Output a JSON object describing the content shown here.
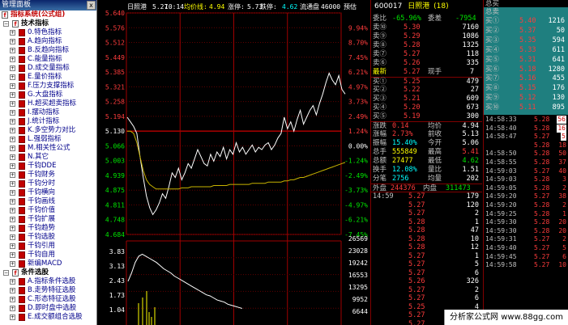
{
  "panel": {
    "title": "管理面板",
    "close": "x",
    "tree": [
      {
        "type": "root",
        "label": "指标系统(公式组)"
      },
      {
        "type": "sec",
        "label": "技术指标"
      },
      {
        "type": "item",
        "label": "0.特色指标"
      },
      {
        "type": "item",
        "label": "A.趋向指标"
      },
      {
        "type": "item",
        "label": "B.反趋向指标"
      },
      {
        "type": "item",
        "label": "C.能量指标"
      },
      {
        "type": "item",
        "label": "D.成交量指标"
      },
      {
        "type": "item",
        "label": "E.量价指标"
      },
      {
        "type": "item",
        "label": "F.压力支撑指标"
      },
      {
        "type": "item",
        "label": "G.大盘指标"
      },
      {
        "type": "item",
        "label": "H.超买超卖指标"
      },
      {
        "type": "item",
        "label": "I.摆动指标"
      },
      {
        "type": "item",
        "label": "J.统计指标"
      },
      {
        "type": "item",
        "label": "K.多空势力对比"
      },
      {
        "type": "item",
        "label": "L.强弱指标"
      },
      {
        "type": "item",
        "label": "M.相关性公式"
      },
      {
        "type": "item",
        "label": "N.其它"
      },
      {
        "type": "item",
        "label": "千钧DDE"
      },
      {
        "type": "item",
        "label": "千钧财务"
      },
      {
        "type": "item",
        "label": "千钧分时"
      },
      {
        "type": "item",
        "label": "千钧横向"
      },
      {
        "type": "item",
        "label": "千钧画线"
      },
      {
        "type": "item",
        "label": "千钧价值"
      },
      {
        "type": "item",
        "label": "千钧扩展"
      },
      {
        "type": "item",
        "label": "千钧趋势"
      },
      {
        "type": "item",
        "label": "千钧选股"
      },
      {
        "type": "item",
        "label": "千钧引用"
      },
      {
        "type": "item",
        "label": "千钧自用"
      },
      {
        "type": "item",
        "label": "新编MACD"
      },
      {
        "type": "sec",
        "label": "条件选股"
      },
      {
        "type": "item",
        "label": "A.指标条件选股"
      },
      {
        "type": "item",
        "label": "B.走势特征选股"
      },
      {
        "type": "item",
        "label": "C.形态特征选股"
      },
      {
        "type": "item",
        "label": "D.即时盘中选股"
      },
      {
        "type": "item",
        "label": "E.成交额组合选股"
      }
    ]
  },
  "chart": {
    "info_name": "日照港",
    "info_time": "5.27",
    "info_clock": "10:14",
    "info_avg_label": "均价线:",
    "info_avg": "4.94",
    "info_chg_label": "涨停:",
    "info_chg": "5.73",
    "info_limit_label": "跌停:",
    "info_limit": "4.62",
    "info_float_label": "流通盘",
    "info_float": "46000",
    "info_warn": "预估",
    "price_labels": [
      "5.640",
      "5.576",
      "5.512",
      "5.449",
      "5.385",
      "5.321",
      "5.258",
      "5.194",
      "5.130",
      "5.066",
      "5.003",
      "4.939",
      "4.875",
      "4.811",
      "4.748",
      "4.684"
    ],
    "pct_labels": [
      "9.94%",
      "8.70%",
      "7.45%",
      "6.21%",
      "4.97%",
      "3.73%",
      "2.49%",
      "1.24%",
      "0.00%",
      "-1.24%",
      "-2.49%",
      "-3.73%",
      "-4.97%",
      "-6.21%",
      "-7.45%"
    ],
    "vol_left_labels": [
      "3.83",
      "3.13",
      "2.43",
      "1.73",
      "1.04"
    ],
    "vol_right_labels": [
      "26569",
      "23028",
      "19242",
      "16553",
      "13295",
      "9952",
      "6644"
    ]
  },
  "chart_data": {
    "type": "line",
    "title": "",
    "xlabel": "",
    "ylabel": "",
    "prev_close": 5.13,
    "ylim": [
      4.684,
      5.64
    ],
    "series": [
      {
        "name": "",
        "values": [
          5.19,
          5.17,
          5.15,
          5.12,
          5.02,
          4.93,
          4.85,
          4.8,
          4.77,
          4.79,
          4.82,
          4.86,
          4.84,
          4.89,
          4.95,
          4.93,
          4.97,
          4.92,
          4.95,
          4.99,
          4.97,
          5.01,
          5.05,
          5.02,
          4.99,
          4.98,
          5.03,
          5.0,
          5.04,
          5.02,
          5.06,
          5.01,
          5.05,
          5.03,
          5.08,
          5.04,
          5.06,
          5.03,
          5.05,
          5.07,
          5.04,
          5.06,
          5.05,
          5.07,
          5.08,
          5.05,
          5.07,
          5.1,
          5.12,
          5.19,
          5.14,
          5.17,
          5.13,
          5.18,
          5.22,
          5.16,
          5.19,
          5.22,
          5.24,
          5.2,
          5.25,
          5.29,
          5.34,
          5.38,
          5.35,
          5.33,
          5.37,
          5.31,
          5.29
        ]
      },
      {
        "name": "",
        "values": [
          5.13,
          5.13,
          5.12,
          5.08,
          5.02,
          4.96,
          4.92,
          4.9,
          4.89,
          4.88,
          4.88,
          4.88,
          4.88,
          4.88,
          4.88,
          4.88,
          4.88,
          4.885,
          4.885,
          4.885,
          4.89,
          4.89,
          4.89,
          4.89,
          4.89,
          4.89,
          4.89,
          4.895,
          4.895,
          4.895,
          4.895,
          4.895,
          4.9,
          4.9,
          4.9,
          4.9,
          4.9,
          4.9,
          4.9,
          4.905,
          4.905,
          4.905,
          4.905,
          4.905,
          4.91,
          4.91,
          4.91,
          4.91,
          4.91,
          4.915,
          4.915,
          4.92,
          4.92,
          4.925,
          4.93,
          4.93,
          4.935,
          4.94,
          4.945,
          4.95,
          4.955,
          4.96,
          4.965,
          4.97,
          4.975,
          4.98,
          4.985,
          4.99,
          4.995
        ]
      }
    ],
    "volume_line": [
      2.4,
      2.8,
      3.3,
      3.6,
      3.7,
      3.6,
      3.5,
      3.4,
      3.3,
      3.15,
      3.0,
      2.9,
      2.8,
      2.65,
      2.55,
      2.45,
      2.35,
      2.25,
      2.15,
      2.05,
      1.95,
      1.85,
      1.75,
      1.7,
      1.6,
      1.5,
      1.45,
      1.4,
      1.3,
      1.25,
      1.2,
      1.15,
      1.1
    ]
  },
  "quote": {
    "code": "600017",
    "name": "日照港",
    "count": "(18)",
    "weibi_label": "委比",
    "weibi": "-65.96%",
    "weicha_label": "委差",
    "weicha": "-7954",
    "sells": [
      {
        "label": "卖⑩",
        "price": "5.30",
        "vol": "7160"
      },
      {
        "label": "卖⑨",
        "price": "5.29",
        "vol": "1086"
      },
      {
        "label": "卖⑧",
        "price": "5.28",
        "vol": "1325"
      },
      {
        "label": "卖⑦",
        "price": "5.27",
        "vol": "118"
      },
      {
        "label": "卖⑥",
        "price": "5.26",
        "vol": "335"
      }
    ],
    "latest_label": "最新",
    "latest": "5.27",
    "xianshou_label": "现手",
    "xianshou": "7",
    "buys": [
      {
        "label": "买①",
        "price": "5.25",
        "vol": "479"
      },
      {
        "label": "买②",
        "price": "5.22",
        "vol": "27"
      },
      {
        "label": "买③",
        "price": "5.21",
        "vol": "609"
      },
      {
        "label": "买④",
        "price": "5.20",
        "vol": "673"
      },
      {
        "label": "买⑤",
        "price": "5.19",
        "vol": "300"
      }
    ],
    "stats": [
      {
        "l1": "涨跌",
        "v1": "0.14",
        "l2": "均价",
        "v2": "4.94"
      },
      {
        "l1": "涨幅",
        "v1": "2.73%",
        "l2": "前收",
        "v2": "5.13"
      },
      {
        "l1": "振幅",
        "v1": "15.40%",
        "l2": "今开",
        "v2": "5.06"
      },
      {
        "l1": "总手",
        "v1": "555849",
        "l2": "最高",
        "v2": "5.41"
      },
      {
        "l1": "总额",
        "v1": "27477",
        "l2": "最低",
        "v2": "4.62"
      },
      {
        "l1": "换手",
        "v1": "12.08%",
        "l2": "量比",
        "v2": "1.51"
      },
      {
        "l1": "分笔",
        "v1": "2756",
        "l2": "均量",
        "v2": "202"
      }
    ],
    "outer_label": "外盘",
    "outer": "244376",
    "inner_label": "内盘",
    "inner": "311473",
    "ticks": [
      {
        "time": "14:59",
        "price": "5.27",
        "vol": "179"
      },
      {
        "time": "",
        "price": "5.27",
        "vol": "120"
      },
      {
        "time": "",
        "price": "5.27",
        "vol": "2"
      },
      {
        "time": "",
        "price": "5.28",
        "vol": "1"
      },
      {
        "time": "",
        "price": "5.28",
        "vol": "47"
      },
      {
        "time": "",
        "price": "5.28",
        "vol": "10"
      },
      {
        "time": "",
        "price": "5.28",
        "vol": "12"
      },
      {
        "time": "",
        "price": "5.27",
        "vol": "1"
      },
      {
        "time": "",
        "price": "5.27",
        "vol": "5"
      },
      {
        "time": "",
        "price": "5.27",
        "vol": "6"
      },
      {
        "time": "",
        "price": "5.26",
        "vol": "326"
      },
      {
        "time": "",
        "price": "5.27",
        "vol": "2"
      },
      {
        "time": "",
        "price": "5.27",
        "vol": "6"
      },
      {
        "time": "",
        "price": "5.25",
        "vol": "4"
      },
      {
        "time": "",
        "price": "5.27",
        "vol": "6"
      },
      {
        "time": "",
        "price": "5.27",
        "vol": "1"
      },
      {
        "time": "",
        "price": "5.27",
        "vol": "1"
      }
    ]
  },
  "right": {
    "header": "总买",
    "header2": "总卖",
    "buys": [
      {
        "label": "买①",
        "price": "5.40",
        "vol": "1216"
      },
      {
        "label": "买②",
        "price": "5.37",
        "vol": "50"
      },
      {
        "label": "买③",
        "price": "5.35",
        "vol": "594"
      },
      {
        "label": "买④",
        "price": "5.33",
        "vol": "611"
      },
      {
        "label": "买⑤",
        "price": "5.31",
        "vol": "641"
      },
      {
        "label": "买⑥",
        "price": "5.18",
        "vol": "1280"
      },
      {
        "label": "买⑦",
        "price": "5.16",
        "vol": "455"
      },
      {
        "label": "买⑧",
        "price": "5.15",
        "vol": "176"
      },
      {
        "label": "买⑨",
        "price": "5.12",
        "vol": "130"
      },
      {
        "label": "买⑩",
        "price": "5.11",
        "vol": "895"
      }
    ],
    "ticks": [
      {
        "time": "14:58:33",
        "price": "5.28",
        "vol": "56"
      },
      {
        "time": "14:58:40",
        "price": "5.28",
        "vol": "16"
      },
      {
        "time": "14:58:47",
        "price": "5.27",
        "vol": "5"
      },
      {
        "time": "",
        "price": "5.28",
        "vol": "18"
      },
      {
        "time": "14:58:50",
        "price": "5.28",
        "vol": "50"
      },
      {
        "time": "14:58:55",
        "price": "5.28",
        "vol": "37"
      },
      {
        "time": "14:59:03",
        "price": "5.27",
        "vol": "40"
      },
      {
        "time": "14:59:03",
        "price": "5.28",
        "vol": "3"
      },
      {
        "time": "14:59:05",
        "price": "5.28",
        "vol": "2"
      },
      {
        "time": "14:59:20",
        "price": "5.27",
        "vol": "38"
      },
      {
        "time": "14:59:20",
        "price": "5.28",
        "vol": "2"
      },
      {
        "time": "14:59:25",
        "price": "5.28",
        "vol": "1"
      },
      {
        "time": "14:59:30",
        "price": "5.28",
        "vol": "20"
      },
      {
        "time": "14:59:30",
        "price": "5.28",
        "vol": "20"
      },
      {
        "time": "14:59:31",
        "price": "5.27",
        "vol": "2"
      },
      {
        "time": "14:59:40",
        "price": "5.27",
        "vol": "5"
      },
      {
        "time": "14:59:45",
        "price": "5.27",
        "vol": "6"
      },
      {
        "time": "14:59:58",
        "price": "5.27",
        "vol": "10"
      }
    ]
  },
  "banner": "分析家公式网 www.88gg.com"
}
